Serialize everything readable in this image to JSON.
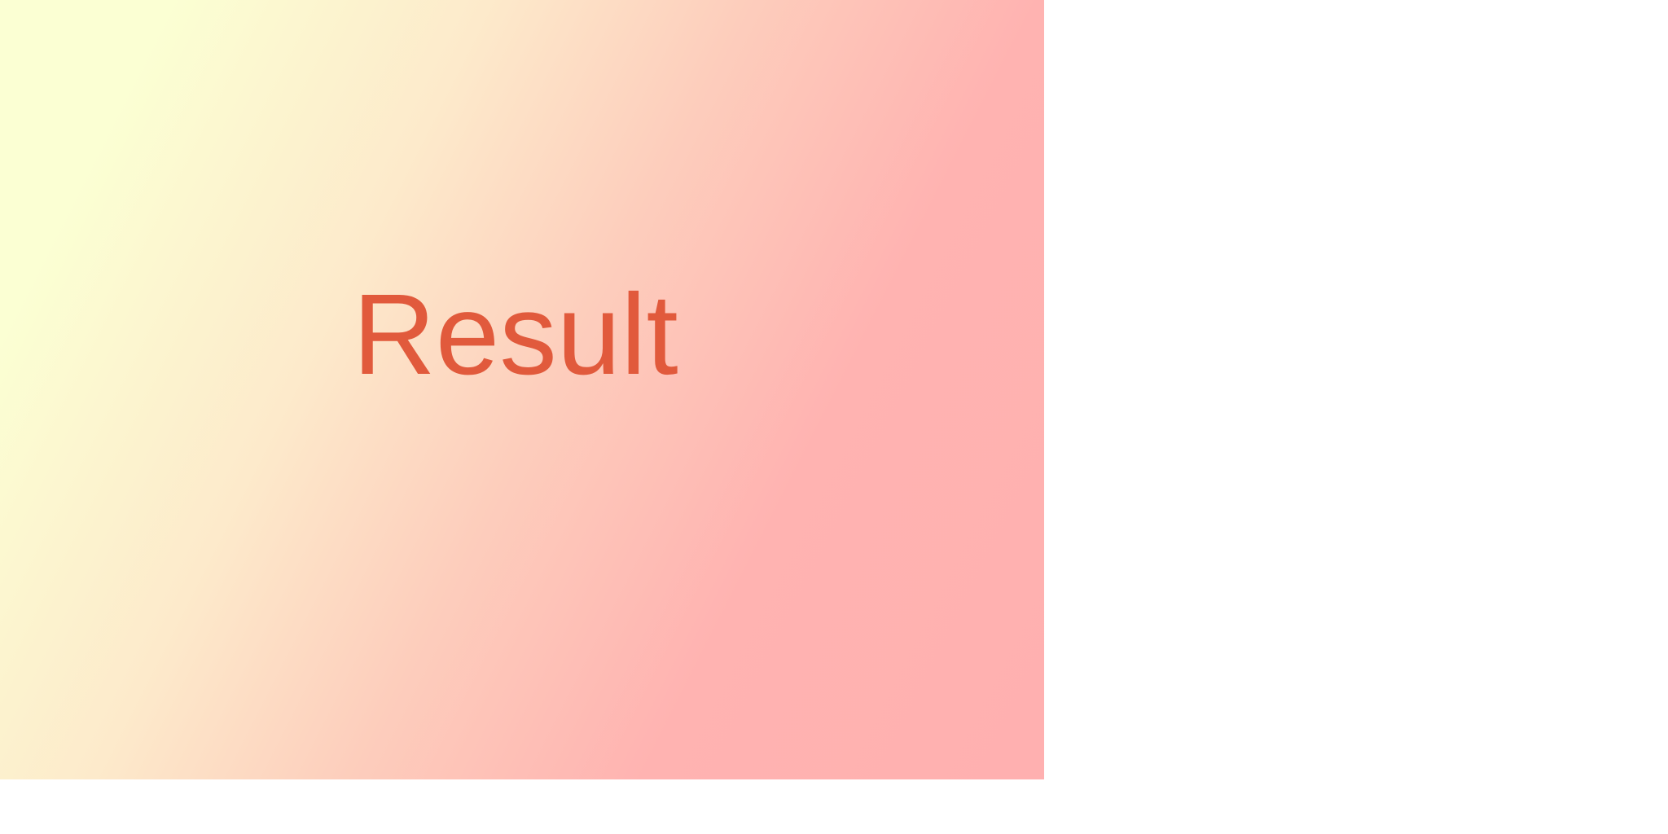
{
  "panel": {
    "text": "Result",
    "text_color": "#e15a3c",
    "gradient_colors": [
      "#fbffd3",
      "#fdeacb",
      "#fdcdbc",
      "#ffb3b1",
      "#ffb0b0"
    ]
  },
  "page_background": "#ffffff"
}
